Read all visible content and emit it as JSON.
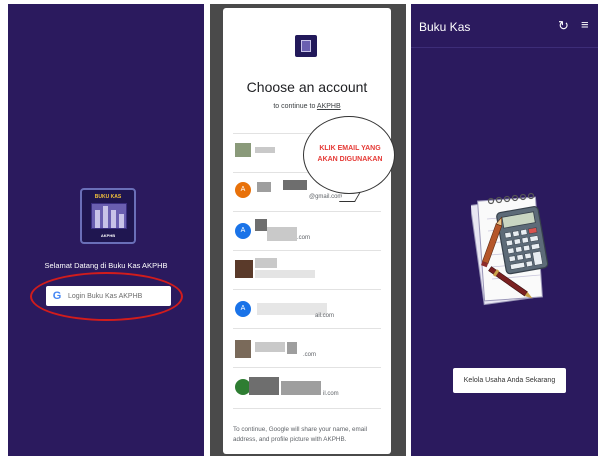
{
  "login_screen": {
    "logo": {
      "title": "BUKU KAS",
      "name": "AKPHB"
    },
    "welcome": "Selamat Datang di Buku Kas AKPHB",
    "login_button": "Login Buku Kas AKPHB",
    "google_icon": "google-g-icon",
    "highlight_color": "#d11c1c"
  },
  "account_chooser": {
    "title": "Choose an account",
    "subtitle_prefix": "to continue to ",
    "subtitle_app": "AKPHB",
    "callout": "KLIK EMAIL YANG AKAN DIGUNAKAN",
    "accounts": [
      {
        "initial": "",
        "email_suffix": ""
      },
      {
        "initial": "A",
        "email_suffix": "@gmail.com"
      },
      {
        "initial": "A",
        "email_suffix": ".com"
      },
      {
        "initial": "",
        "email_suffix": ""
      },
      {
        "initial": "A",
        "email_suffix": "ail.com"
      },
      {
        "initial": "",
        "email_suffix": ".com"
      },
      {
        "initial": "",
        "email_suffix": "il.com"
      }
    ],
    "footer": "To continue, Google will share your name, email address, and profile picture with AKPHB."
  },
  "home_screen": {
    "app_title": "Buku Kas",
    "sync_icon": "sync-icon",
    "menu_icon": "menu-icon",
    "cta_button": "Kelola Usaha Anda Sekarang"
  },
  "colors": {
    "brand_purple": "#2b1a5e",
    "callout_red": "#e53935",
    "google_blue": "#4285f4"
  }
}
